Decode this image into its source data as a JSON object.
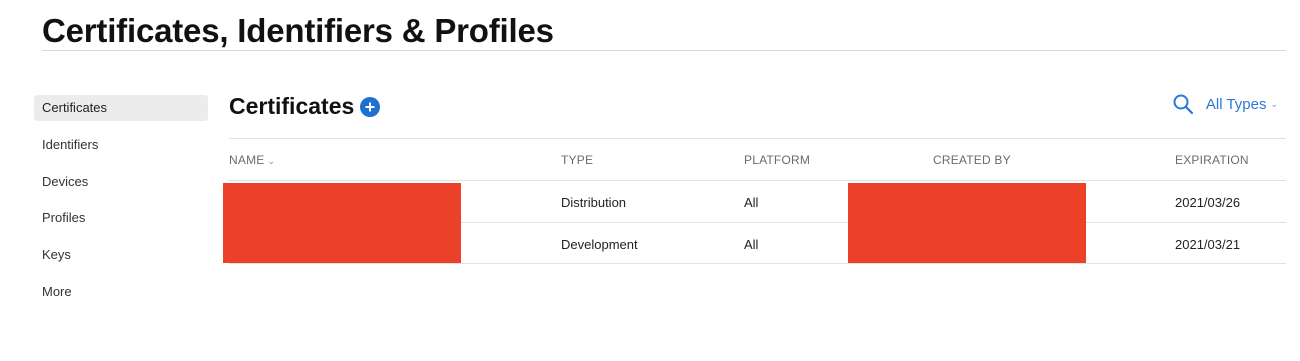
{
  "page": {
    "title": "Certificates, Identifiers & Profiles"
  },
  "sidebar": {
    "items": [
      {
        "label": "Certificates",
        "active": true
      },
      {
        "label": "Identifiers"
      },
      {
        "label": "Devices"
      },
      {
        "label": "Profiles"
      },
      {
        "label": "Keys"
      },
      {
        "label": "More"
      }
    ]
  },
  "main": {
    "section_title": "Certificates",
    "add_icon": "plus-circle-icon",
    "search_icon": "search-icon",
    "type_filter": "All Types",
    "columns": {
      "name": "NAME",
      "type": "TYPE",
      "platform": "PLATFORM",
      "created_by": "CREATED BY",
      "expiration": "EXPIRATION"
    },
    "rows": [
      {
        "type": "Distribution",
        "platform": "All",
        "expiration": "2021/03/26"
      },
      {
        "type": "Development",
        "platform": "All",
        "expiration": "2021/03/21"
      }
    ]
  },
  "colors": {
    "accent": "#1f6fd1",
    "link": "#2b78d9",
    "redaction": "#ea4128"
  }
}
